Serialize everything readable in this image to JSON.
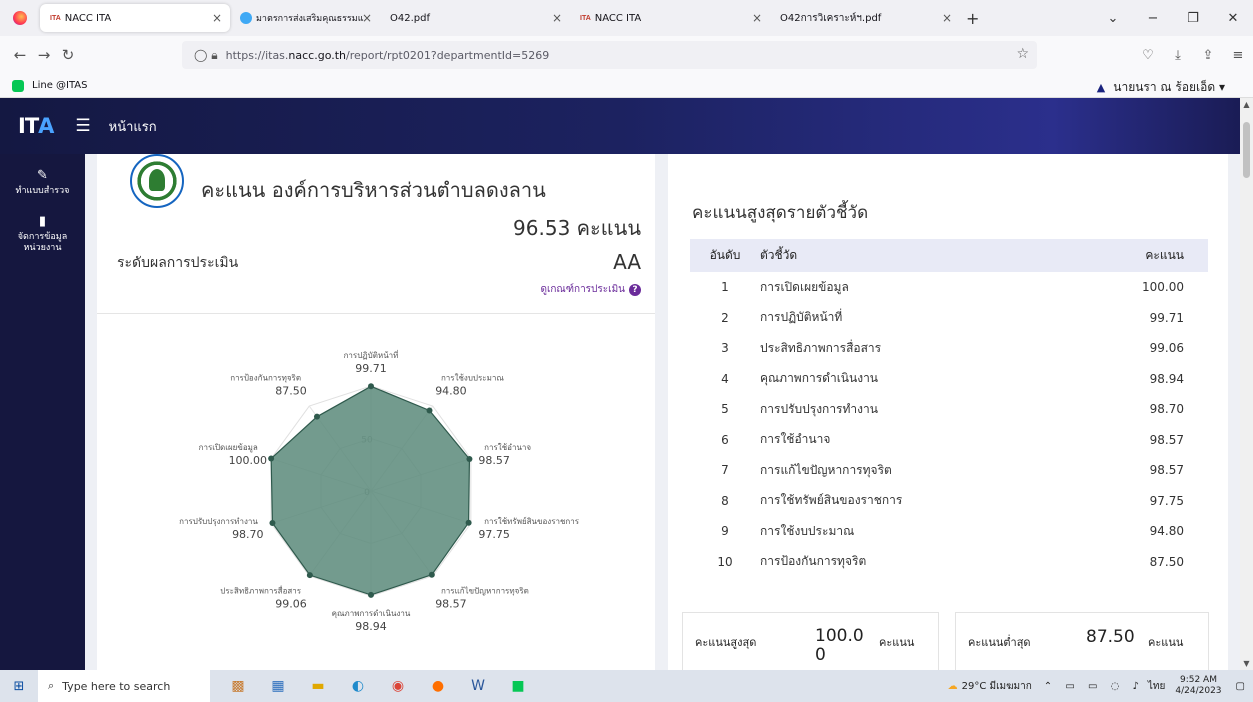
{
  "browser": {
    "tabs": [
      {
        "icon": "ITA",
        "label": "NACC ITA",
        "active": true
      },
      {
        "icon": "globe",
        "label": "มาตรการส่งเสริมคุณธรรมและความ",
        "active": false
      },
      {
        "icon": "",
        "label": "O42.pdf",
        "active": false
      },
      {
        "icon": "ITA",
        "label": "NACC ITA",
        "active": false
      },
      {
        "icon": "",
        "label": "O42การวิเคราะห์ฯ.pdf",
        "active": false
      }
    ],
    "url_prefix": "https://itas.",
    "url_domain": "nacc.go.th",
    "url_path": "/report/rpt0201?departmentId=5269",
    "bookmark": "Line @ITAS"
  },
  "user": {
    "name": "นายนรา ณ ร้อยเอ็ด ▾"
  },
  "header": {
    "logo_main": "IT",
    "logo_accent": "A",
    "home": "หน้าแรก"
  },
  "sidebar": {
    "items": [
      {
        "icon": "survey-icon",
        "label": "ทำแบบสำรวจ"
      },
      {
        "icon": "clipboard-icon",
        "label": "จัดการข้อมูลหน่วยงาน"
      }
    ]
  },
  "summary": {
    "title": "คะแนน องค์การบริหารส่วนตำบลดงลาน",
    "score": "96.53 คะแนน",
    "level_label": "ระดับผลการประเมิน",
    "level_value": "AA",
    "criteria_link": "ดูเกณฑ์การประเมิน"
  },
  "radar": {
    "axes": [
      {
        "name": "การปฏิบัติหน้าที่",
        "value": 99.71,
        "value_text": "99.71"
      },
      {
        "name": "การใช้งบประมาณ",
        "value": 94.8,
        "value_text": "94.80"
      },
      {
        "name": "การใช้อำนาจ",
        "value": 98.57,
        "value_text": "98.57"
      },
      {
        "name": "การใช้ทรัพย์สินของราชการ",
        "value": 97.75,
        "value_text": "97.75"
      },
      {
        "name": "การแก้ไขปัญหาการทุจริต",
        "value": 98.57,
        "value_text": "98.57"
      },
      {
        "name": "คุณภาพการดำเนินงาน",
        "value": 98.94,
        "value_text": "98.94"
      },
      {
        "name": "ประสิทธิภาพการสื่อสาร",
        "value": 99.06,
        "value_text": "99.06"
      },
      {
        "name": "การปรับปรุงการทำงาน",
        "value": 98.7,
        "value_text": "98.70"
      },
      {
        "name": "การเปิดเผยข้อมูล",
        "value": 100.0,
        "value_text": "100.00"
      },
      {
        "name": "การป้องกันการทุจริต",
        "value": 87.5,
        "value_text": "87.50"
      }
    ],
    "max": 100,
    "tick_labels": [
      "0",
      "50"
    ],
    "fill_color": "#5a8a7a",
    "stroke_color": "#2f5a4d"
  },
  "ranking": {
    "title": "คะแนนสูงสุดรายตัวชี้วัด",
    "headers": [
      "อันดับ",
      "ตัวชี้วัด",
      "คะแนน"
    ],
    "rows": [
      [
        "1",
        "การเปิดเผยข้อมูล",
        "100.00"
      ],
      [
        "2",
        "การปฏิบัติหน้าที่",
        "99.71"
      ],
      [
        "3",
        "ประสิทธิภาพการสื่อสาร",
        "99.06"
      ],
      [
        "4",
        "คุณภาพการดำเนินงาน",
        "98.94"
      ],
      [
        "5",
        "การปรับปรุงการทำงาน",
        "98.70"
      ],
      [
        "6",
        "การใช้อำนาจ",
        "98.57"
      ],
      [
        "7",
        "การแก้ไขปัญหาการทุจริต",
        "98.57"
      ],
      [
        "8",
        "การใช้ทรัพย์สินของราชการ",
        "97.75"
      ],
      [
        "9",
        "การใช้งบประมาณ",
        "94.80"
      ],
      [
        "10",
        "การป้องกันการทุจริต",
        "87.50"
      ]
    ]
  },
  "stats": {
    "max_label": "คะแนนสูงสุด",
    "max_value_line1": "100.0",
    "max_value_line2": "0",
    "max_unit": "คะแนน",
    "min_label": "คะแนนต่ำสุด",
    "min_value": "87.50",
    "min_unit": "คะแนน"
  },
  "taskbar": {
    "search_placeholder": "Type here to search",
    "weather": "29°C มีเมฆมาก",
    "lang": "ไทย",
    "time": "9:52 AM",
    "date": "4/24/2023"
  }
}
